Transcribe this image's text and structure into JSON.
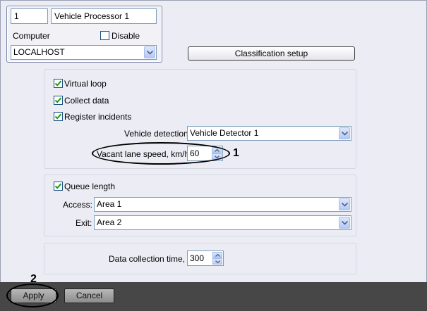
{
  "object": {
    "id": "1",
    "name": "Vehicle Processor 1"
  },
  "computer": {
    "label": "Computer",
    "value": "LOCALHOST",
    "disable_label": "Disable",
    "disabled": false
  },
  "classification_button": "Classification setup",
  "detection": {
    "virtual_loop": {
      "label": "Virtual loop",
      "checked": true
    },
    "collect_data": {
      "label": "Collect data",
      "checked": true
    },
    "register_incidents": {
      "label": "Register incidents",
      "checked": true
    },
    "vehicle_detection": {
      "label": "Vehicle detection:",
      "value": "Vehicle Detector 1"
    },
    "vacant_speed": {
      "label": "Vacant lane speed, km/h:",
      "value": "60"
    }
  },
  "queue": {
    "queue_length": {
      "label": "Queue length",
      "checked": true
    },
    "access": {
      "label": "Access:",
      "value": "Area 1"
    },
    "exit": {
      "label": "Exit:",
      "value": "Area 2"
    }
  },
  "data_collection": {
    "label": "Data collection time, s:",
    "value": "300"
  },
  "footer": {
    "apply": "Apply",
    "cancel": "Cancel"
  },
  "callouts": {
    "c1": "1",
    "c2": "2"
  },
  "colors": {
    "check": "#1a9a1a",
    "bottom_bar": "#474747",
    "field_border": "#7f9db9"
  }
}
